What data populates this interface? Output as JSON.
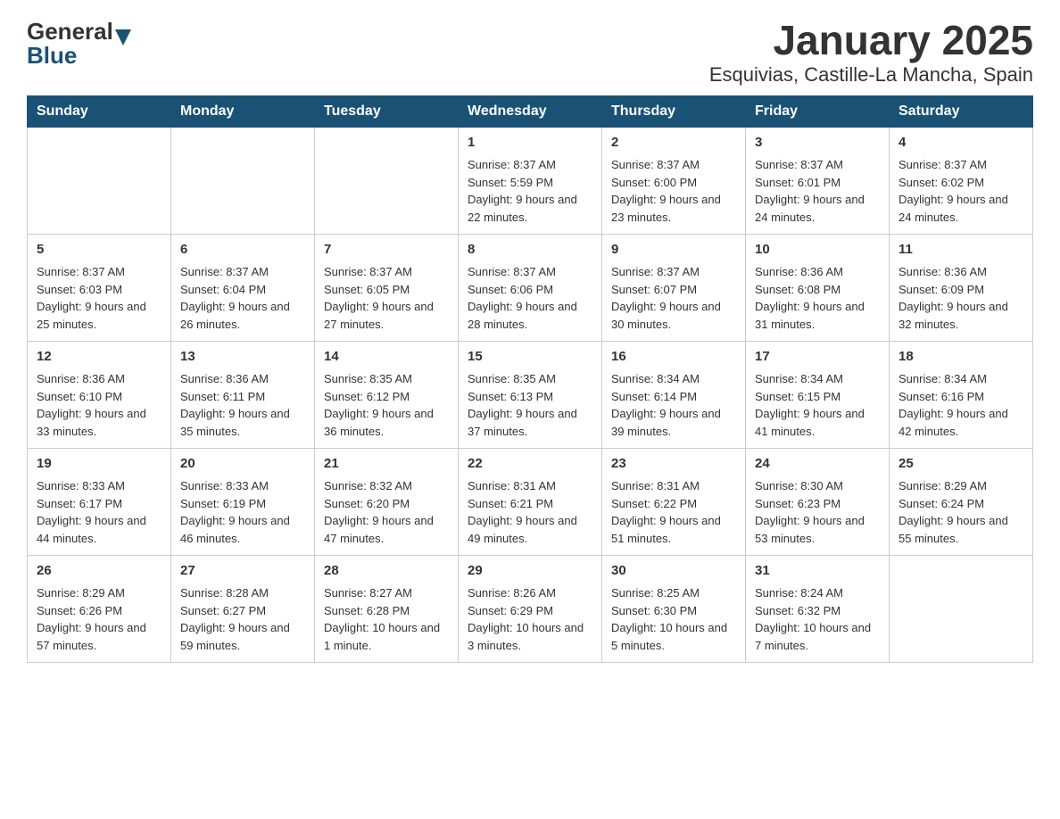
{
  "header": {
    "logo_general": "General",
    "logo_blue": "Blue",
    "title": "January 2025",
    "subtitle": "Esquivias, Castille-La Mancha, Spain"
  },
  "weekdays": [
    "Sunday",
    "Monday",
    "Tuesday",
    "Wednesday",
    "Thursday",
    "Friday",
    "Saturday"
  ],
  "weeks": [
    [
      {
        "day": "",
        "info": ""
      },
      {
        "day": "",
        "info": ""
      },
      {
        "day": "",
        "info": ""
      },
      {
        "day": "1",
        "sunrise": "Sunrise: 8:37 AM",
        "sunset": "Sunset: 5:59 PM",
        "daylight": "Daylight: 9 hours and 22 minutes."
      },
      {
        "day": "2",
        "sunrise": "Sunrise: 8:37 AM",
        "sunset": "Sunset: 6:00 PM",
        "daylight": "Daylight: 9 hours and 23 minutes."
      },
      {
        "day": "3",
        "sunrise": "Sunrise: 8:37 AM",
        "sunset": "Sunset: 6:01 PM",
        "daylight": "Daylight: 9 hours and 24 minutes."
      },
      {
        "day": "4",
        "sunrise": "Sunrise: 8:37 AM",
        "sunset": "Sunset: 6:02 PM",
        "daylight": "Daylight: 9 hours and 24 minutes."
      }
    ],
    [
      {
        "day": "5",
        "sunrise": "Sunrise: 8:37 AM",
        "sunset": "Sunset: 6:03 PM",
        "daylight": "Daylight: 9 hours and 25 minutes."
      },
      {
        "day": "6",
        "sunrise": "Sunrise: 8:37 AM",
        "sunset": "Sunset: 6:04 PM",
        "daylight": "Daylight: 9 hours and 26 minutes."
      },
      {
        "day": "7",
        "sunrise": "Sunrise: 8:37 AM",
        "sunset": "Sunset: 6:05 PM",
        "daylight": "Daylight: 9 hours and 27 minutes."
      },
      {
        "day": "8",
        "sunrise": "Sunrise: 8:37 AM",
        "sunset": "Sunset: 6:06 PM",
        "daylight": "Daylight: 9 hours and 28 minutes."
      },
      {
        "day": "9",
        "sunrise": "Sunrise: 8:37 AM",
        "sunset": "Sunset: 6:07 PM",
        "daylight": "Daylight: 9 hours and 30 minutes."
      },
      {
        "day": "10",
        "sunrise": "Sunrise: 8:36 AM",
        "sunset": "Sunset: 6:08 PM",
        "daylight": "Daylight: 9 hours and 31 minutes."
      },
      {
        "day": "11",
        "sunrise": "Sunrise: 8:36 AM",
        "sunset": "Sunset: 6:09 PM",
        "daylight": "Daylight: 9 hours and 32 minutes."
      }
    ],
    [
      {
        "day": "12",
        "sunrise": "Sunrise: 8:36 AM",
        "sunset": "Sunset: 6:10 PM",
        "daylight": "Daylight: 9 hours and 33 minutes."
      },
      {
        "day": "13",
        "sunrise": "Sunrise: 8:36 AM",
        "sunset": "Sunset: 6:11 PM",
        "daylight": "Daylight: 9 hours and 35 minutes."
      },
      {
        "day": "14",
        "sunrise": "Sunrise: 8:35 AM",
        "sunset": "Sunset: 6:12 PM",
        "daylight": "Daylight: 9 hours and 36 minutes."
      },
      {
        "day": "15",
        "sunrise": "Sunrise: 8:35 AM",
        "sunset": "Sunset: 6:13 PM",
        "daylight": "Daylight: 9 hours and 37 minutes."
      },
      {
        "day": "16",
        "sunrise": "Sunrise: 8:34 AM",
        "sunset": "Sunset: 6:14 PM",
        "daylight": "Daylight: 9 hours and 39 minutes."
      },
      {
        "day": "17",
        "sunrise": "Sunrise: 8:34 AM",
        "sunset": "Sunset: 6:15 PM",
        "daylight": "Daylight: 9 hours and 41 minutes."
      },
      {
        "day": "18",
        "sunrise": "Sunrise: 8:34 AM",
        "sunset": "Sunset: 6:16 PM",
        "daylight": "Daylight: 9 hours and 42 minutes."
      }
    ],
    [
      {
        "day": "19",
        "sunrise": "Sunrise: 8:33 AM",
        "sunset": "Sunset: 6:17 PM",
        "daylight": "Daylight: 9 hours and 44 minutes."
      },
      {
        "day": "20",
        "sunrise": "Sunrise: 8:33 AM",
        "sunset": "Sunset: 6:19 PM",
        "daylight": "Daylight: 9 hours and 46 minutes."
      },
      {
        "day": "21",
        "sunrise": "Sunrise: 8:32 AM",
        "sunset": "Sunset: 6:20 PM",
        "daylight": "Daylight: 9 hours and 47 minutes."
      },
      {
        "day": "22",
        "sunrise": "Sunrise: 8:31 AM",
        "sunset": "Sunset: 6:21 PM",
        "daylight": "Daylight: 9 hours and 49 minutes."
      },
      {
        "day": "23",
        "sunrise": "Sunrise: 8:31 AM",
        "sunset": "Sunset: 6:22 PM",
        "daylight": "Daylight: 9 hours and 51 minutes."
      },
      {
        "day": "24",
        "sunrise": "Sunrise: 8:30 AM",
        "sunset": "Sunset: 6:23 PM",
        "daylight": "Daylight: 9 hours and 53 minutes."
      },
      {
        "day": "25",
        "sunrise": "Sunrise: 8:29 AM",
        "sunset": "Sunset: 6:24 PM",
        "daylight": "Daylight: 9 hours and 55 minutes."
      }
    ],
    [
      {
        "day": "26",
        "sunrise": "Sunrise: 8:29 AM",
        "sunset": "Sunset: 6:26 PM",
        "daylight": "Daylight: 9 hours and 57 minutes."
      },
      {
        "day": "27",
        "sunrise": "Sunrise: 8:28 AM",
        "sunset": "Sunset: 6:27 PM",
        "daylight": "Daylight: 9 hours and 59 minutes."
      },
      {
        "day": "28",
        "sunrise": "Sunrise: 8:27 AM",
        "sunset": "Sunset: 6:28 PM",
        "daylight": "Daylight: 10 hours and 1 minute."
      },
      {
        "day": "29",
        "sunrise": "Sunrise: 8:26 AM",
        "sunset": "Sunset: 6:29 PM",
        "daylight": "Daylight: 10 hours and 3 minutes."
      },
      {
        "day": "30",
        "sunrise": "Sunrise: 8:25 AM",
        "sunset": "Sunset: 6:30 PM",
        "daylight": "Daylight: 10 hours and 5 minutes."
      },
      {
        "day": "31",
        "sunrise": "Sunrise: 8:24 AM",
        "sunset": "Sunset: 6:32 PM",
        "daylight": "Daylight: 10 hours and 7 minutes."
      },
      {
        "day": "",
        "info": ""
      }
    ]
  ]
}
